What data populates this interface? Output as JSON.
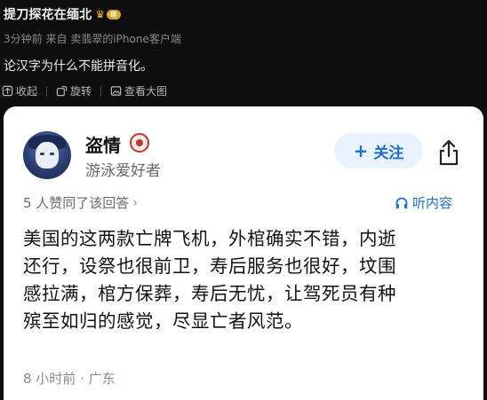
{
  "post": {
    "author": "提刀探花在缅北",
    "level_badge": "Ⅲ",
    "meta": {
      "time": "3分钟前",
      "source_prefix": "来自",
      "source": "卖翡翠的iPhone客户端"
    },
    "text": "论汉字为什么不能拼音化。",
    "tools": {
      "collapse": "收起",
      "rotate": "旋转",
      "view_large": "查看大图"
    }
  },
  "card": {
    "name": "盗情",
    "description": "游泳爱好者",
    "follow_button": "关注",
    "likes_text": "5 人赞同了该回答",
    "likes_arrow": "›",
    "listen": "听内容",
    "answer_lines": [
      "美国的这两款亡牌飞机，外棺确实不错，内逝",
      "还行，设祭也很前卫，寿后服务也很好，坟围",
      "感拉满，棺方保葬，寿后无忧，让驾死员有种",
      "殡至如归的感觉，尽显亡者风范。"
    ],
    "time_location": "8 小时前 · 广东"
  },
  "colors": {
    "page_bg": "#0e0e0e",
    "card_bg": "#ffffff",
    "accent_blue": "#1e6fd0",
    "follow_bg": "#e9f3fd",
    "badge_gold": "#e0a820"
  }
}
